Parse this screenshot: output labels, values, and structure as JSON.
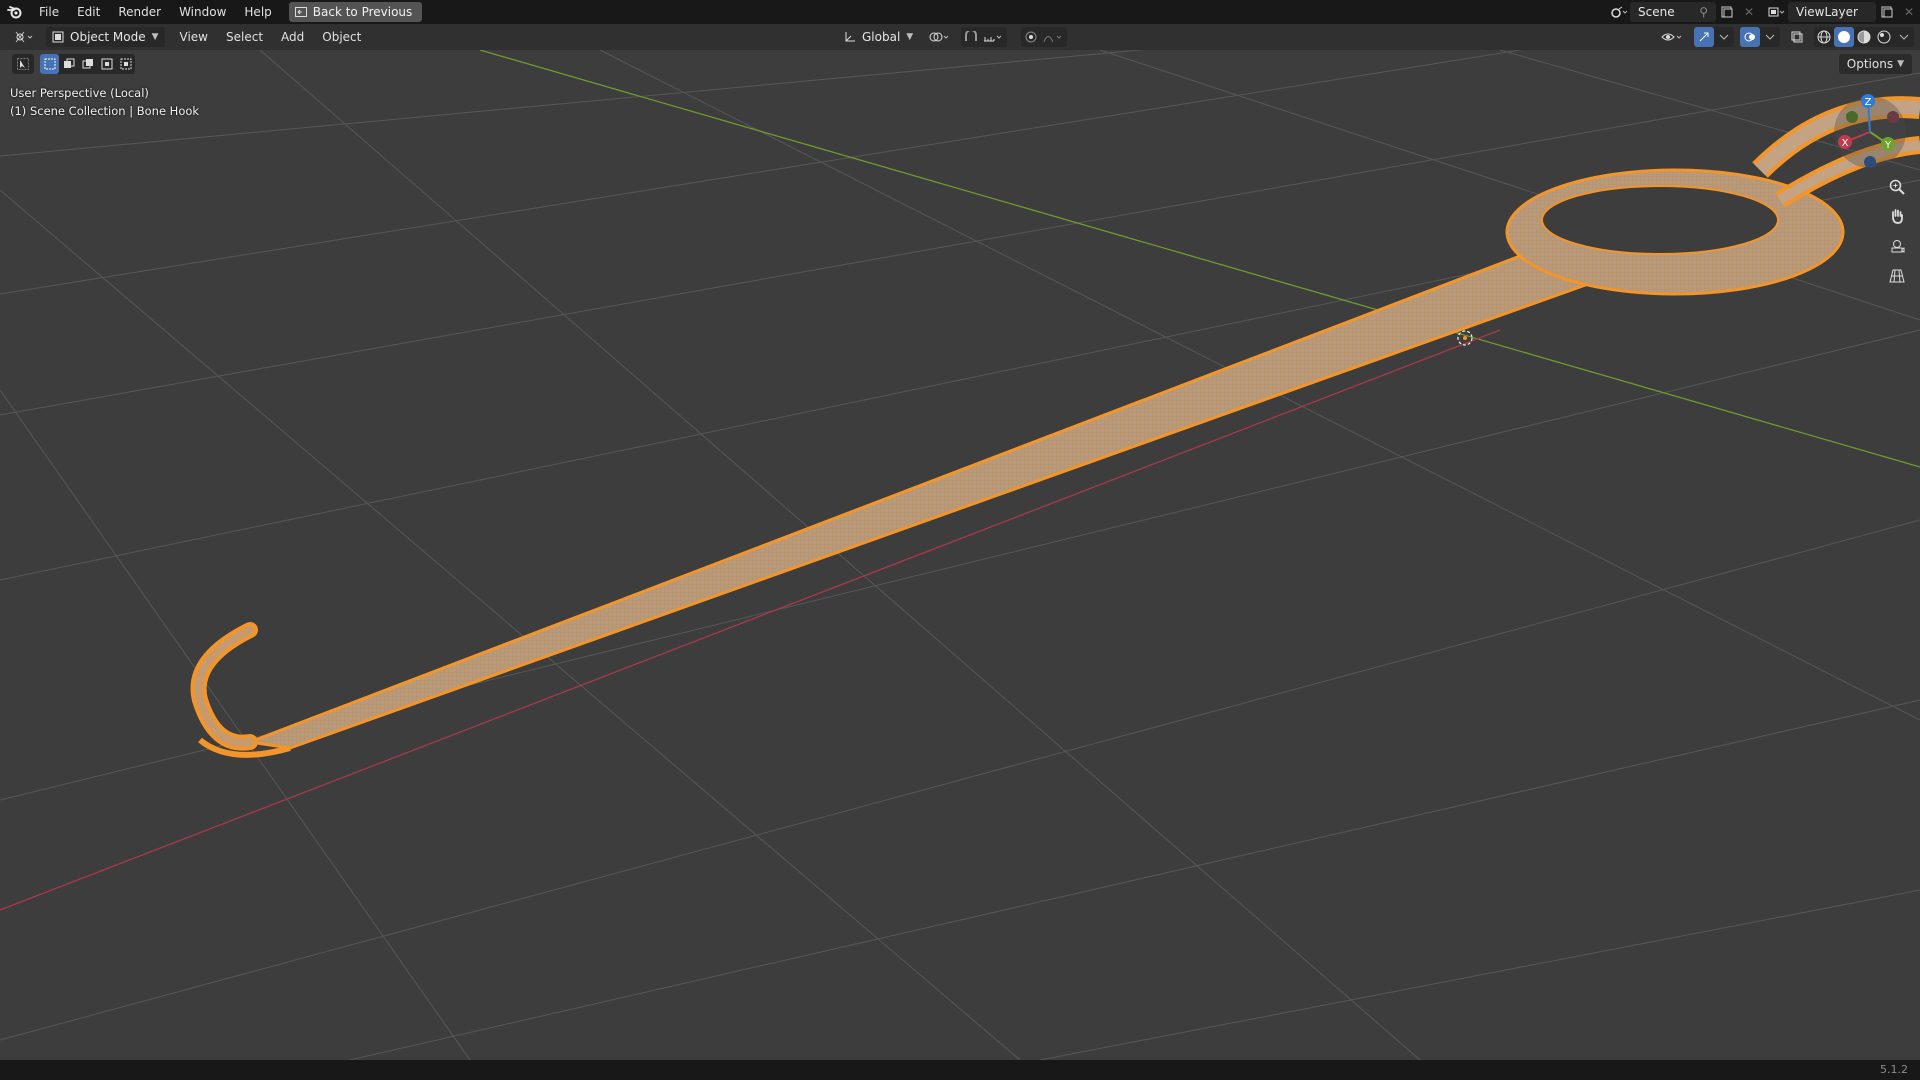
{
  "topbar": {
    "menus": [
      "File",
      "Edit",
      "Render",
      "Window",
      "Help"
    ],
    "back_button": "Back to Previous",
    "scene_name": "Scene",
    "view_layer": "ViewLayer"
  },
  "header": {
    "mode": "Object Mode",
    "menus": [
      "View",
      "Select",
      "Add",
      "Object"
    ],
    "transform_orientation": "Global"
  },
  "viewport": {
    "perspective_label": "User Perspective (Local)",
    "collection_label": "(1) Scene Collection | Bone Hook",
    "options_label": "Options",
    "gizmo": {
      "x": "X",
      "y": "Y",
      "z": "Z"
    },
    "colors": {
      "background": "#3d3d3d",
      "grid": "#575757",
      "x_axis": "#a8394a",
      "y_axis": "#6e9a2e",
      "selection": "#f2952a",
      "mesh": "#b89a7c"
    }
  },
  "statusbar": {
    "version": "5.1.2"
  }
}
